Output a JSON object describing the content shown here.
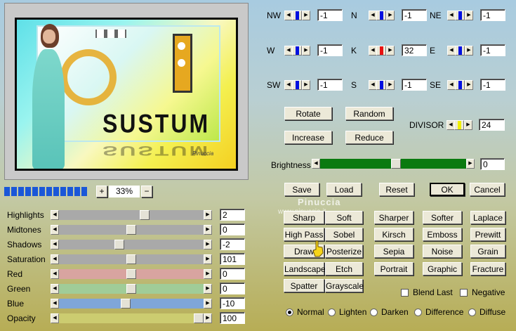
{
  "preview": {
    "title": "SUSTUM",
    "watermark": "Pinuccia",
    "watermark_url": "www.pinuccia.it"
  },
  "zoom": {
    "plus": "+",
    "minus": "−",
    "value": "33%"
  },
  "kernel": [
    {
      "label": "NW",
      "value": "-1",
      "marker": "blue"
    },
    {
      "label": "N",
      "value": "-1",
      "marker": "blue"
    },
    {
      "label": "NE",
      "value": "-1",
      "marker": "blue"
    },
    {
      "label": "W",
      "value": "-1",
      "marker": "blue"
    },
    {
      "label": "K",
      "value": "32",
      "marker": "red"
    },
    {
      "label": "E",
      "value": "-1",
      "marker": "blue"
    },
    {
      "label": "SW",
      "value": "-1",
      "marker": "blue"
    },
    {
      "label": "S",
      "value": "-1",
      "marker": "blue"
    },
    {
      "label": "SE",
      "value": "-1",
      "marker": "blue"
    }
  ],
  "buttons": {
    "rotate": "Rotate",
    "random": "Random",
    "increase": "Increase",
    "reduce": "Reduce",
    "save": "Save",
    "load": "Load",
    "reset": "Reset",
    "ok": "OK",
    "cancel": "Cancel"
  },
  "divisor": {
    "label": "DIVISOR",
    "value": "24"
  },
  "brightness": {
    "label": "Brightness",
    "value": "0",
    "level": 0.52
  },
  "watermark_site": "www.pinuccia.it",
  "presets": [
    [
      "Sharp",
      "Soft",
      "Sharper",
      "Softer",
      "Laplace"
    ],
    [
      "High Pass",
      "Sobel",
      "Kirsch",
      "Emboss",
      "Prewitt"
    ],
    [
      "Draw",
      "Posterize",
      "Sepia",
      "Noise",
      "Grain"
    ],
    [
      "Landscape",
      "Etch",
      "Portrait",
      "Graphic",
      "Fracture"
    ],
    [
      "Spatter",
      "Grayscale"
    ]
  ],
  "options": {
    "blend_last": "Blend Last",
    "negative": "Negative"
  },
  "modes": [
    {
      "label": "Normal",
      "selected": true
    },
    {
      "label": "Lighten",
      "selected": false
    },
    {
      "label": "Darken",
      "selected": false
    },
    {
      "label": "Difference",
      "selected": false
    },
    {
      "label": "Diffuse",
      "selected": false
    }
  ],
  "adjust": [
    {
      "label": "Highlights",
      "value": "2",
      "level": 0.6,
      "color": "#a9a9a9"
    },
    {
      "label": "Midtones",
      "value": "0",
      "level": 0.5,
      "color": "#a9a9a9"
    },
    {
      "label": "Shadows",
      "value": "-2",
      "level": 0.41,
      "color": "#a9a9a9"
    },
    {
      "label": "Saturation",
      "value": "101",
      "level": 0.5,
      "color": "#a9a9a9"
    },
    {
      "label": "Red",
      "value": "0",
      "level": 0.5,
      "color": "#d8a4a0"
    },
    {
      "label": "Green",
      "value": "0",
      "level": 0.5,
      "color": "#a0cc98"
    },
    {
      "label": "Blue",
      "value": "-10",
      "level": 0.46,
      "color": "#7fa6d8"
    },
    {
      "label": "Opacity",
      "value": "100",
      "level": 1.0,
      "color": "#cccc70"
    }
  ]
}
